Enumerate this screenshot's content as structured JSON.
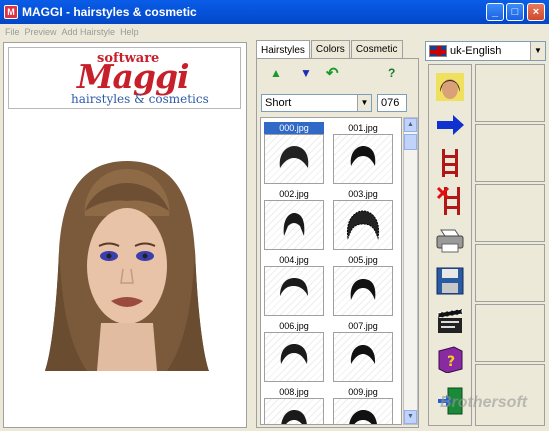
{
  "window": {
    "title": "MAGGI - hairstyles & cosmetic",
    "app_icon_glyph": "M",
    "minimize": "_",
    "maximize": "□",
    "close": "×"
  },
  "menu": [
    "File",
    "Preview",
    "Add Hairstyle",
    "Help"
  ],
  "logo": {
    "software": "software",
    "brand": "Maggi",
    "tagline": "hairstyles & cosmetics"
  },
  "tabs": [
    "Hairstyles",
    "Colors",
    "Cosmetic"
  ],
  "toolbar": {
    "up": "▲",
    "down": "▼",
    "undo": "↶",
    "help": "?"
  },
  "category": {
    "value": "Short",
    "dropdown_glyph": "▼"
  },
  "count": "076",
  "thumbnails": [
    {
      "label": "000.jpg",
      "selected": true
    },
    {
      "label": "001.jpg"
    },
    {
      "label": "002.jpg"
    },
    {
      "label": "003.jpg"
    },
    {
      "label": "004.jpg"
    },
    {
      "label": "005.jpg"
    },
    {
      "label": "006.jpg"
    },
    {
      "label": "007.jpg"
    },
    {
      "label": "008.jpg"
    },
    {
      "label": "009.jpg"
    }
  ],
  "scrollbar": {
    "up": "▲",
    "down": "▼"
  },
  "language": {
    "value": "uk-English",
    "dropdown_glyph": "▼"
  },
  "tools": [
    "face-icon",
    "arrow-right-icon",
    "ladder-icon",
    "ladder-delete-icon",
    "printer-icon",
    "save-disk-icon",
    "scene-take-icon",
    "help-book-icon",
    "exit-door-icon"
  ],
  "watermark": "Brothersoft"
}
